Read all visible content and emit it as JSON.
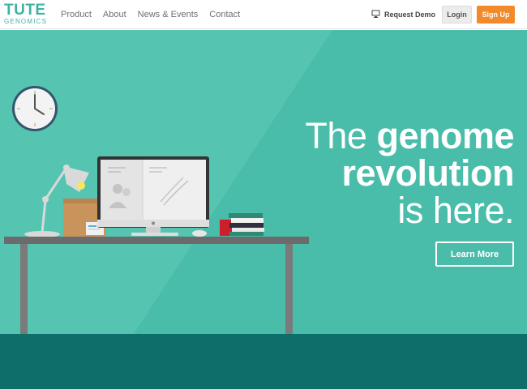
{
  "header": {
    "logo_top": "TUTE",
    "logo_bottom": "GENOMICS",
    "nav": [
      {
        "label": "Product"
      },
      {
        "label": "About"
      },
      {
        "label": "News & Events"
      },
      {
        "label": "Contact"
      }
    ],
    "request_demo": {
      "label": "Request Demo",
      "icon": "monitor-icon"
    },
    "login_label": "Login",
    "signup_label": "Sign Up"
  },
  "hero": {
    "headline": {
      "line1_thin": "The ",
      "line1_bold": "genome",
      "line2_bold": "revolution",
      "line3_thin": "is here."
    },
    "cta_label": "Learn More"
  },
  "colors": {
    "brand": "#3fb3a3",
    "hero_bg": "#49bda9",
    "bottom_band": "#0e6e69",
    "signup": "#f28a2b"
  }
}
